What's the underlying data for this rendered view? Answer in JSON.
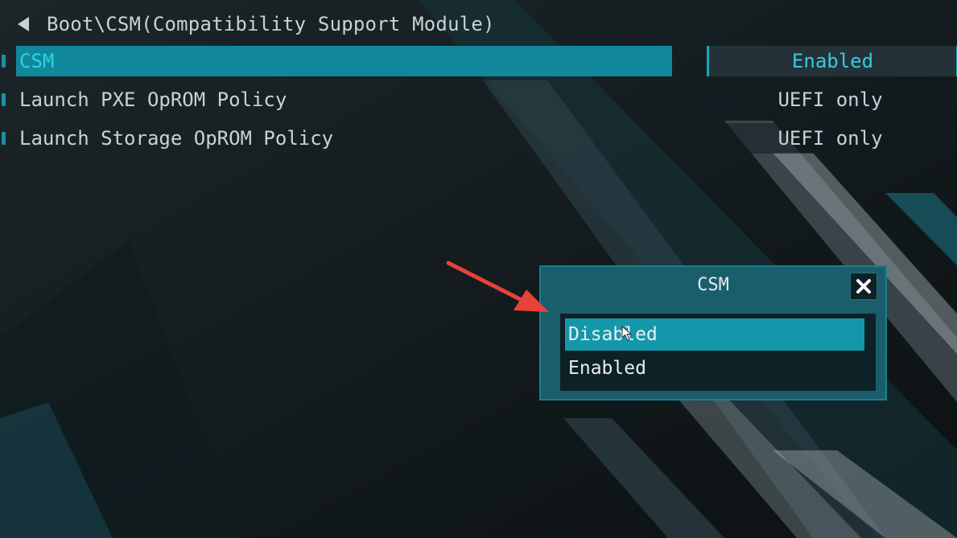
{
  "breadcrumb": {
    "path": "Boot\\CSM(Compatibility Support Module)"
  },
  "settings": [
    {
      "label": "CSM",
      "value": "Enabled",
      "selected": true
    },
    {
      "label": "Launch PXE OpROM Policy",
      "value": "UEFI only",
      "selected": false
    },
    {
      "label": "Launch Storage OpROM Policy",
      "value": "UEFI only",
      "selected": false
    }
  ],
  "dialog": {
    "title": "CSM",
    "options": [
      {
        "label": "Disabled",
        "selected": true
      },
      {
        "label": "Enabled",
        "selected": false
      }
    ]
  },
  "colors": {
    "accent": "#11879b",
    "selected_text": "#2fd2e8",
    "annotation_arrow": "#e8413a"
  }
}
